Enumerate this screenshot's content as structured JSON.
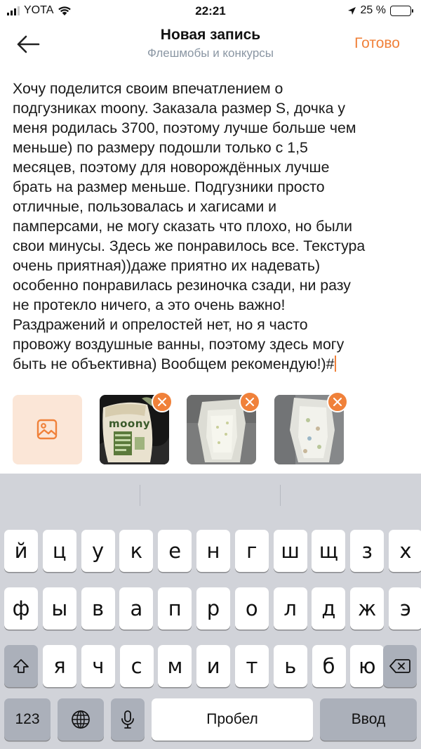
{
  "status_bar": {
    "carrier": "YOTA",
    "time": "22:21",
    "battery": "25 %",
    "battery_level": 0.25
  },
  "nav": {
    "title": "Новая запись",
    "subtitle": "Флешмобы и конкурсы",
    "done_label": "Готово",
    "back_icon": "arrow-left-icon"
  },
  "post": {
    "text": "Хочу поделится своим впечатлением о\nподгузниках moony. Заказала размер S, дочка у\nменя родилась 3700, поэтому лучше больше чем\nменьше) по размеру подошли только с 1,5\nмесяцев, поэтому для новорождённых лучше\nбрать на размер меньше. Подгузники просто\nотличные, пользовалась и хагисами и\nпамперсами, не могу сказать что плохо, но были\nсвои минусы. Здесь же понравилось все. Текстура\nочень приятная))даже приятно их надевать)\nособенно понравилась резиночка сзади, ни разу\nне протекло ничего, а это очень важно!\nРаздражений и опрелостей нет, но я часто\nпровожу воздушные ванны, поэтому здесь могу\nбыть не объективна) Вообщем рекомендую!)#"
  },
  "attachments": {
    "add_icon": "image-icon",
    "photos": [
      {
        "name": "photo-moony-pack",
        "brand_text": "moony"
      },
      {
        "name": "photo-diaper-1"
      },
      {
        "name": "photo-diaper-2"
      }
    ],
    "accent_color": "#f0813a"
  },
  "keyboard": {
    "row1": [
      "й",
      "ц",
      "у",
      "к",
      "е",
      "н",
      "г",
      "ш",
      "щ",
      "з",
      "х"
    ],
    "row2": [
      "ф",
      "ы",
      "в",
      "а",
      "п",
      "р",
      "о",
      "л",
      "д",
      "ж",
      "э"
    ],
    "row3": [
      "я",
      "ч",
      "с",
      "м",
      "и",
      "т",
      "ь",
      "б",
      "ю"
    ],
    "numbers_label": "123",
    "space_label": "Пробел",
    "return_label": "Ввод"
  }
}
